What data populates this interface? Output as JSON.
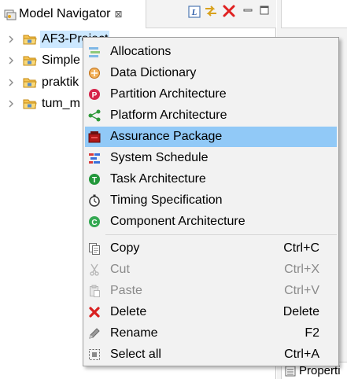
{
  "navigator": {
    "title": "Model Navigator",
    "close_glyph": "⊠",
    "tree": [
      {
        "label": "AF3-Project",
        "selected": true
      },
      {
        "label": "Simple"
      },
      {
        "label": "praktik"
      },
      {
        "label": "tum_m"
      }
    ],
    "toolbar": {
      "link": "link-with-editor-icon",
      "sync": "sync-icon",
      "delete": "delete-icon",
      "minimize": "minimize-icon",
      "maximize": "maximize-icon"
    }
  },
  "side": {
    "bottom_label": "Properti"
  },
  "menu": {
    "new_items": [
      {
        "label": "Allocations",
        "icon": "allocations-icon"
      },
      {
        "label": "Data Dictionary",
        "icon": "data-dictionary-icon"
      },
      {
        "label": "Partition Architecture",
        "icon": "partition-architecture-icon"
      },
      {
        "label": "Platform Architecture",
        "icon": "platform-architecture-icon"
      },
      {
        "label": "Assurance Package",
        "icon": "assurance-package-icon",
        "highlighted": true
      },
      {
        "label": "System Schedule",
        "icon": "system-schedule-icon"
      },
      {
        "label": "Task Architecture",
        "icon": "task-architecture-icon"
      },
      {
        "label": "Timing Specification",
        "icon": "timing-specification-icon"
      },
      {
        "label": "Component Architecture",
        "icon": "component-architecture-icon"
      }
    ],
    "edit_items": [
      {
        "label": "Copy",
        "shortcut": "Ctrl+C",
        "icon": "copy-icon",
        "enabled": true
      },
      {
        "label": "Cut",
        "shortcut": "Ctrl+X",
        "icon": "cut-icon",
        "enabled": false
      },
      {
        "label": "Paste",
        "shortcut": "Ctrl+V",
        "icon": "paste-icon",
        "enabled": false
      },
      {
        "label": "Delete",
        "shortcut": "Delete",
        "icon": "delete-icon",
        "enabled": true
      },
      {
        "label": "Rename",
        "shortcut": "F2",
        "icon": "rename-icon",
        "enabled": true
      },
      {
        "label": "Select all",
        "shortcut": "Ctrl+A",
        "icon": "select-all-icon",
        "enabled": true
      }
    ],
    "highlight_color": "#91c9f7"
  }
}
